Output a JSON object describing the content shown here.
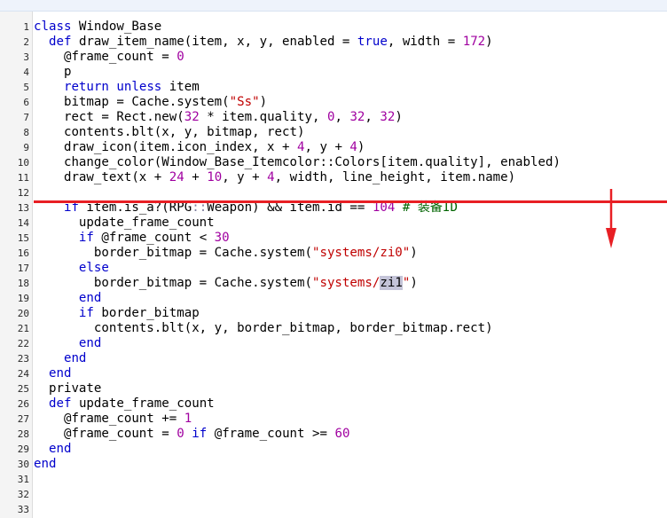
{
  "editor": {
    "lines": [
      {
        "n": "1",
        "indent": "",
        "tokens": [
          {
            "t": "kw",
            "v": "class"
          },
          {
            "t": "tx",
            "v": " Window_Base"
          }
        ]
      },
      {
        "n": "2",
        "indent": "  ",
        "tokens": [
          {
            "t": "kw",
            "v": "def"
          },
          {
            "t": "tx",
            "v": " draw_item_name(item, x, y, enabled = "
          },
          {
            "t": "kw",
            "v": "true"
          },
          {
            "t": "tx",
            "v": ", width = "
          },
          {
            "t": "num",
            "v": "172"
          },
          {
            "t": "tx",
            "v": ")"
          }
        ]
      },
      {
        "n": "3",
        "indent": "    ",
        "tokens": [
          {
            "t": "tx",
            "v": "@frame_count = "
          },
          {
            "t": "num",
            "v": "0"
          }
        ]
      },
      {
        "n": "4",
        "indent": "    ",
        "tokens": [
          {
            "t": "tx",
            "v": "p"
          }
        ]
      },
      {
        "n": "5",
        "indent": "    ",
        "tokens": [
          {
            "t": "kw",
            "v": "return"
          },
          {
            "t": "tx",
            "v": " "
          },
          {
            "t": "kw",
            "v": "unless"
          },
          {
            "t": "tx",
            "v": " item"
          }
        ]
      },
      {
        "n": "6",
        "indent": "    ",
        "tokens": [
          {
            "t": "tx",
            "v": "bitmap = Cache.system("
          },
          {
            "t": "str",
            "v": "\"Ss\""
          },
          {
            "t": "tx",
            "v": ")"
          }
        ]
      },
      {
        "n": "7",
        "indent": "    ",
        "tokens": [
          {
            "t": "tx",
            "v": "rect = Rect.new("
          },
          {
            "t": "num",
            "v": "32"
          },
          {
            "t": "tx",
            "v": " * item.quality, "
          },
          {
            "t": "num",
            "v": "0"
          },
          {
            "t": "tx",
            "v": ", "
          },
          {
            "t": "num",
            "v": "32"
          },
          {
            "t": "tx",
            "v": ", "
          },
          {
            "t": "num",
            "v": "32"
          },
          {
            "t": "tx",
            "v": ")"
          }
        ]
      },
      {
        "n": "8",
        "indent": "    ",
        "tokens": [
          {
            "t": "tx",
            "v": "contents.blt(x, y, bitmap, rect)"
          }
        ]
      },
      {
        "n": "9",
        "indent": "    ",
        "tokens": [
          {
            "t": "tx",
            "v": "draw_icon(item.icon_index, x + "
          },
          {
            "t": "num",
            "v": "4"
          },
          {
            "t": "tx",
            "v": ", y + "
          },
          {
            "t": "num",
            "v": "4"
          },
          {
            "t": "tx",
            "v": ")"
          }
        ]
      },
      {
        "n": "10",
        "indent": "    ",
        "tokens": [
          {
            "t": "tx",
            "v": "change_color(Window_Base_Itemcolor::Colors[item.quality], enabled)"
          }
        ]
      },
      {
        "n": "11",
        "indent": "    ",
        "tokens": [
          {
            "t": "tx",
            "v": "draw_text(x + "
          },
          {
            "t": "num",
            "v": "24"
          },
          {
            "t": "tx",
            "v": " + "
          },
          {
            "t": "num",
            "v": "10"
          },
          {
            "t": "tx",
            "v": ", y + "
          },
          {
            "t": "num",
            "v": "4"
          },
          {
            "t": "tx",
            "v": ", width, line_height, item.name)"
          }
        ]
      },
      {
        "n": "12",
        "indent": "",
        "tokens": []
      },
      {
        "n": "13",
        "indent": "    ",
        "tokens": [
          {
            "t": "kw",
            "v": "if"
          },
          {
            "t": "tx",
            "v": " item.is_a?(RPG"
          },
          {
            "t": "sym",
            "v": "::"
          },
          {
            "t": "tx",
            "v": "Weapon) && item.id == "
          },
          {
            "t": "num",
            "v": "104"
          },
          {
            "t": "tx",
            "v": " "
          },
          {
            "t": "cmt",
            "v": "# 装备ID"
          }
        ]
      },
      {
        "n": "14",
        "indent": "      ",
        "tokens": [
          {
            "t": "tx",
            "v": "update_frame_count"
          }
        ]
      },
      {
        "n": "15",
        "indent": "      ",
        "tokens": [
          {
            "t": "kw",
            "v": "if"
          },
          {
            "t": "tx",
            "v": " @frame_count < "
          },
          {
            "t": "num",
            "v": "30"
          }
        ]
      },
      {
        "n": "16",
        "indent": "        ",
        "tokens": [
          {
            "t": "tx",
            "v": "border_bitmap = Cache.system("
          },
          {
            "t": "str",
            "v": "\"systems/zi0\""
          },
          {
            "t": "tx",
            "v": ")"
          }
        ]
      },
      {
        "n": "17",
        "indent": "      ",
        "tokens": [
          {
            "t": "kw",
            "v": "else"
          }
        ]
      },
      {
        "n": "18",
        "indent": "        ",
        "tokens": [
          {
            "t": "tx",
            "v": "border_bitmap = Cache.system("
          },
          {
            "t": "str",
            "v": "\"systems/"
          },
          {
            "t": "hl",
            "v": "zi1"
          },
          {
            "t": "str",
            "v": "\""
          },
          {
            "t": "tx",
            "v": ")"
          }
        ]
      },
      {
        "n": "19",
        "indent": "      ",
        "tokens": [
          {
            "t": "kw",
            "v": "end"
          }
        ]
      },
      {
        "n": "20",
        "indent": "      ",
        "tokens": [
          {
            "t": "kw",
            "v": "if"
          },
          {
            "t": "tx",
            "v": " border_bitmap"
          }
        ]
      },
      {
        "n": "21",
        "indent": "        ",
        "tokens": [
          {
            "t": "tx",
            "v": "contents.blt(x, y, border_bitmap, border_bitmap.rect)"
          }
        ]
      },
      {
        "n": "22",
        "indent": "      ",
        "tokens": [
          {
            "t": "kw",
            "v": "end"
          }
        ]
      },
      {
        "n": "23",
        "indent": "    ",
        "tokens": [
          {
            "t": "kw",
            "v": "end"
          }
        ]
      },
      {
        "n": "24",
        "indent": "  ",
        "tokens": [
          {
            "t": "kw",
            "v": "end"
          }
        ]
      },
      {
        "n": "25",
        "indent": "  ",
        "tokens": [
          {
            "t": "tx",
            "v": "private"
          }
        ]
      },
      {
        "n": "26",
        "indent": "  ",
        "tokens": [
          {
            "t": "kw",
            "v": "def"
          },
          {
            "t": "tx",
            "v": " update_frame_count"
          }
        ]
      },
      {
        "n": "27",
        "indent": "    ",
        "tokens": [
          {
            "t": "tx",
            "v": "@frame_count += "
          },
          {
            "t": "num",
            "v": "1"
          }
        ]
      },
      {
        "n": "28",
        "indent": "    ",
        "tokens": [
          {
            "t": "tx",
            "v": "@frame_count = "
          },
          {
            "t": "num",
            "v": "0"
          },
          {
            "t": "tx",
            "v": " "
          },
          {
            "t": "kw",
            "v": "if"
          },
          {
            "t": "tx",
            "v": " @frame_count >= "
          },
          {
            "t": "num",
            "v": "60"
          }
        ]
      },
      {
        "n": "29",
        "indent": "  ",
        "tokens": [
          {
            "t": "kw",
            "v": "end"
          }
        ]
      },
      {
        "n": "30",
        "indent": "",
        "tokens": [
          {
            "t": "kw",
            "v": "end"
          }
        ]
      },
      {
        "n": "31",
        "indent": "",
        "tokens": []
      },
      {
        "n": "32",
        "indent": "",
        "tokens": []
      },
      {
        "n": "33",
        "indent": "",
        "tokens": []
      }
    ]
  },
  "annotation": {
    "line_color": "#e81f24",
    "arrow_color": "#e81f24",
    "arrow_icon": "down-arrow-icon"
  },
  "colors": {
    "keyword": "#0000cc",
    "string": "#c00000",
    "number": "#a000a0",
    "comment": "#006400",
    "highlight": "#c4c4d8"
  }
}
